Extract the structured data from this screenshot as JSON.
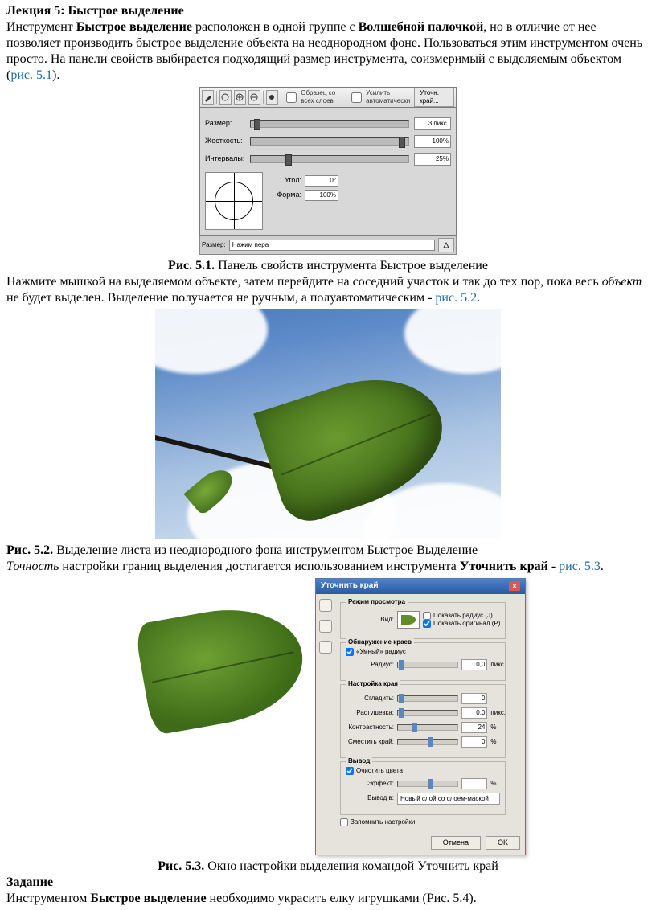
{
  "heading": "Лекция 5: Быстрое выделение",
  "p1": {
    "t1": "Инструмент ",
    "b1": "Быстрое выделение",
    "t2": " расположен в одной группе с ",
    "b2": "Волшебной палочкой",
    "t3": ", но в отличие от нее позволяет производить быстрое выделение объекта на неоднородном фоне. Пользоваться этим инструментом очень просто. На панели свойств выбирается подходящий размер инструмента, соизмеримый с выделяемым объектом (",
    "link": "рис. 5.1",
    "t4": ")."
  },
  "fig51": {
    "toolbar": {
      "check1": "Образец со всех слоев",
      "check2": "Усилить автоматически",
      "refine_btn": "Уточн. край..."
    },
    "props": {
      "size_label": "Размер:",
      "size_val": "3 пикс.",
      "hard_label": "Жесткость:",
      "hard_val": "100%",
      "interval_label": "Интервалы:",
      "interval_val": "25%",
      "angle_label": "Угол:",
      "angle_val": "0°",
      "form_label": "Форма:",
      "form_val": "100%"
    },
    "footer": {
      "label": "Размер:",
      "value": "Нажим пера"
    }
  },
  "caption51": {
    "b": "Рис. 5.1.",
    "t": " Панель свойств инструмента Быстрое выделение"
  },
  "p2": {
    "t1": "Нажмите мышкой на выделяемом объекте, затем перейдите на соседний участок и так до тех пор, пока весь ",
    "i": "объект",
    "t2": " не будет выделен. Выделение получается не ручным, а полуавтоматическим - ",
    "link": "рис. 5.2",
    "t3": "."
  },
  "caption52": {
    "b": "Рис. 5.2.",
    "t": " Выделение листа из неоднородного фона инструментом Быстрое Выделение"
  },
  "p3": {
    "i": "Точность",
    "t1": " настройки границ выделения достигается использованием инструмента ",
    "b": "Уточнить край",
    "t2": " - ",
    "link": "рис. 5.3",
    "t3": "."
  },
  "fig53": {
    "title": "Уточнить край",
    "group_view": {
      "title": "Режим просмотра",
      "view_label": "Вид:",
      "chk_radius": "Показать радиус (J)",
      "chk_orig": "Показать оригинал (P)"
    },
    "group_edge": {
      "title": "Обнаружение краев",
      "chk_smart": "«Умный» радиус",
      "radius_label": "Радиус:",
      "radius_val": "0,0",
      "radius_unit": "пикс."
    },
    "group_adjust": {
      "title": "Настройка края",
      "smooth_label": "Сгладить:",
      "smooth_val": "0",
      "feather_label": "Растушевка:",
      "feather_val": "0,0",
      "feather_unit": "пикс.",
      "contrast_label": "Контрастность:",
      "contrast_val": "24",
      "contrast_unit": "%",
      "shift_label": "Сместить край:",
      "shift_val": "0",
      "shift_unit": "%"
    },
    "group_out": {
      "title": "Вывод",
      "chk_clean": "Очистить цвета",
      "effect_label": "Эффект:",
      "out_label": "Вывод в:",
      "out_value": "Новый слой со слоем-маской"
    },
    "chk_remember": "Запомнить настройки",
    "btn_cancel": "Отмена",
    "btn_ok": "OK"
  },
  "caption53": {
    "b": "Рис. 5.3.",
    "t": " Окно настройки выделения командой Уточнить край"
  },
  "task_h": "Задание",
  "task_p": {
    "t1": "Инструментом ",
    "b": "Быстрое выделение",
    "t2": " необходимо украсить елку игрушками (Рис. 5.4)."
  }
}
